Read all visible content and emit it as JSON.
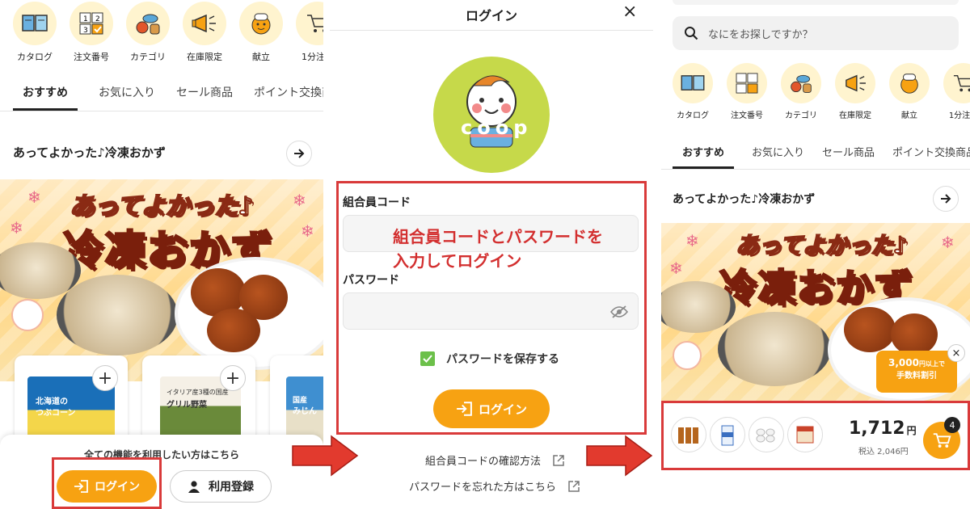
{
  "categories": [
    {
      "label": "カタログ",
      "icon": "catalog-book-icon"
    },
    {
      "label": "注文番号",
      "icon": "order-number-icon"
    },
    {
      "label": "カテゴリ",
      "icon": "category-food-icon"
    },
    {
      "label": "在庫限定",
      "icon": "megaphone-icon"
    },
    {
      "label": "献立",
      "icon": "menu-chef-icon"
    },
    {
      "label": "1分注文",
      "icon": "quick-cart-icon"
    }
  ],
  "tabs": [
    "おすすめ",
    "お気に入り",
    "セール商品",
    "ポイント交換商品"
  ],
  "section_title": "あってよかった♪冷凍おかず",
  "banner": {
    "line1": "あってよかった♪",
    "line2": "冷凍おかず"
  },
  "products": [
    {
      "pack_line1": "北海道の",
      "pack_line2": "つぶコーン"
    },
    {
      "pack_line1": "イタリア産3種の国産",
      "pack_line2": "グリル野菜"
    },
    {
      "pack_line1": "国産",
      "pack_line2": "みじん"
    }
  ],
  "bottom_sheet": {
    "prompt": "全ての機能を利用したい方はこちら",
    "login": "ログイン",
    "register": "利用登録"
  },
  "login_screen": {
    "title": "ログイン",
    "close": "×",
    "member_code_label": "組合員コード",
    "password_label": "パスワード",
    "annotation_line1": "組合員コードとパスワードを",
    "annotation_line2": "入力してログイン",
    "save_password": "パスワードを保存する",
    "login_button": "ログイン",
    "confirm_code_link": "組合員コードの確認方法",
    "forgot_password_link": "パスワードを忘れた方はこちら",
    "logo_text": "coop"
  },
  "home": {
    "search_placeholder": "なにをお探しですか？",
    "promo_amount": "3,000",
    "promo_unit": "円以上で",
    "promo_text": "手数料割引",
    "promo_close": "×",
    "cart_price": "1,712",
    "cart_price_unit": "円",
    "cart_tax": "税込 2,046円",
    "cart_count": "4"
  },
  "colors": {
    "accent": "#f7a212",
    "annotation_red": "#d93a3a",
    "annotation_text": "#d32f2f",
    "check_green": "#6cc04a",
    "icon_bg": "#fff4cf"
  }
}
